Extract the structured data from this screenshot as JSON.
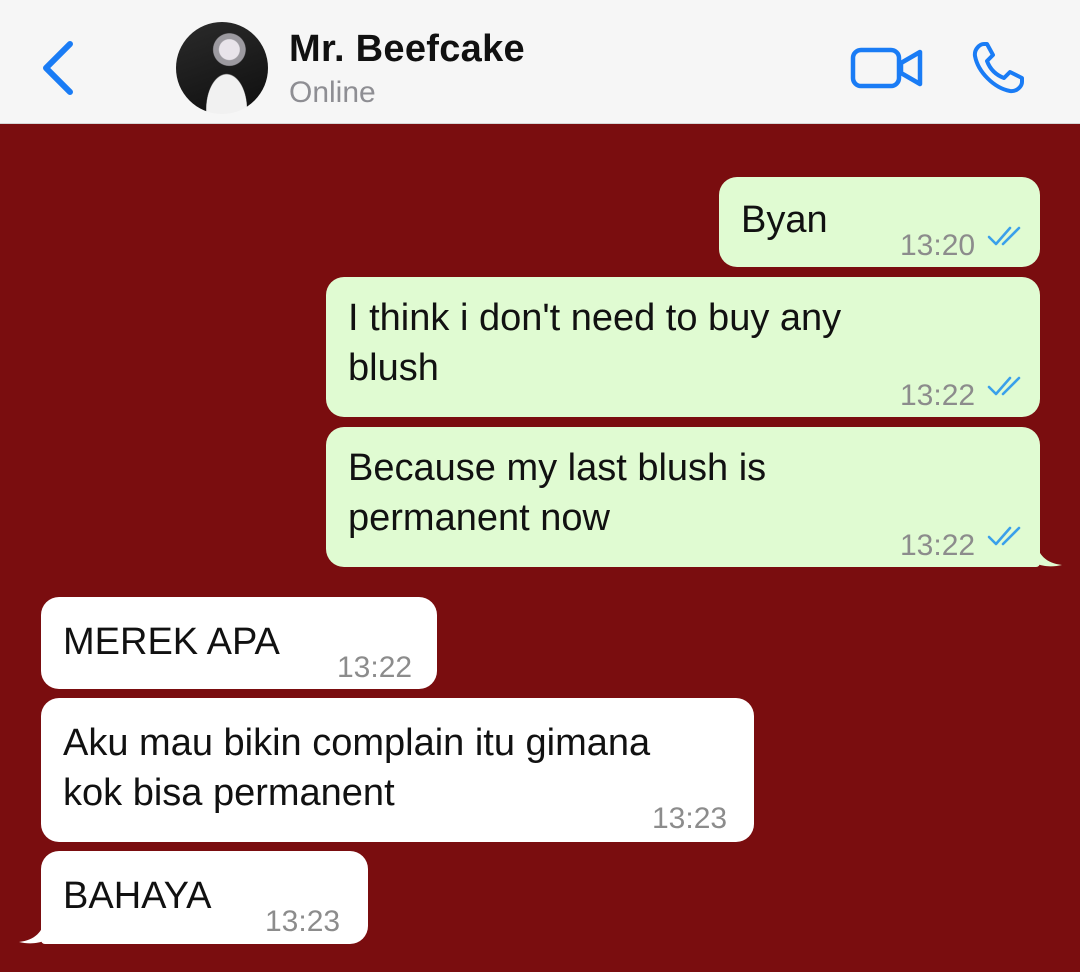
{
  "header": {
    "contact_name": "Mr. Beefcake",
    "status": "Online",
    "back_icon": "chevron-left-icon",
    "video_icon": "video-camera-icon",
    "phone_icon": "phone-icon",
    "accent_color": "#1a7cf5"
  },
  "chat": {
    "background_color": "#7a0d0f",
    "messages": [
      {
        "direction": "outgoing",
        "text": "Byan",
        "time": "13:20",
        "status": "read"
      },
      {
        "direction": "outgoing",
        "text": "I think i don't need to buy any\nblush",
        "time": "13:22",
        "status": "read"
      },
      {
        "direction": "outgoing",
        "text": "Because my last blush is\npermanent now",
        "time": "13:22",
        "status": "read"
      },
      {
        "direction": "incoming",
        "text": "MEREK APA",
        "time": "13:22"
      },
      {
        "direction": "incoming",
        "text": "Aku mau bikin complain itu gimana\nkok bisa permanent",
        "time": "13:23"
      },
      {
        "direction": "incoming",
        "text": "BAHAYA",
        "time": "13:23"
      }
    ]
  }
}
